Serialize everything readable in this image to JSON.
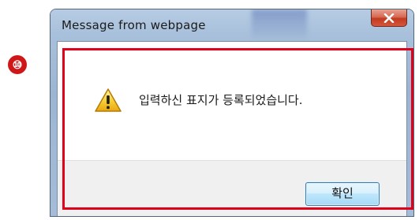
{
  "annotation": {
    "number": "⑩"
  },
  "dialog": {
    "title": "Message from webpage",
    "close_label": "x",
    "message": "입력하신 표지가 등록되었습니다.",
    "icon": "warning-icon",
    "ok_label": "확인"
  },
  "colors": {
    "highlight": "#e0001a",
    "annotation": "#cf1717"
  }
}
